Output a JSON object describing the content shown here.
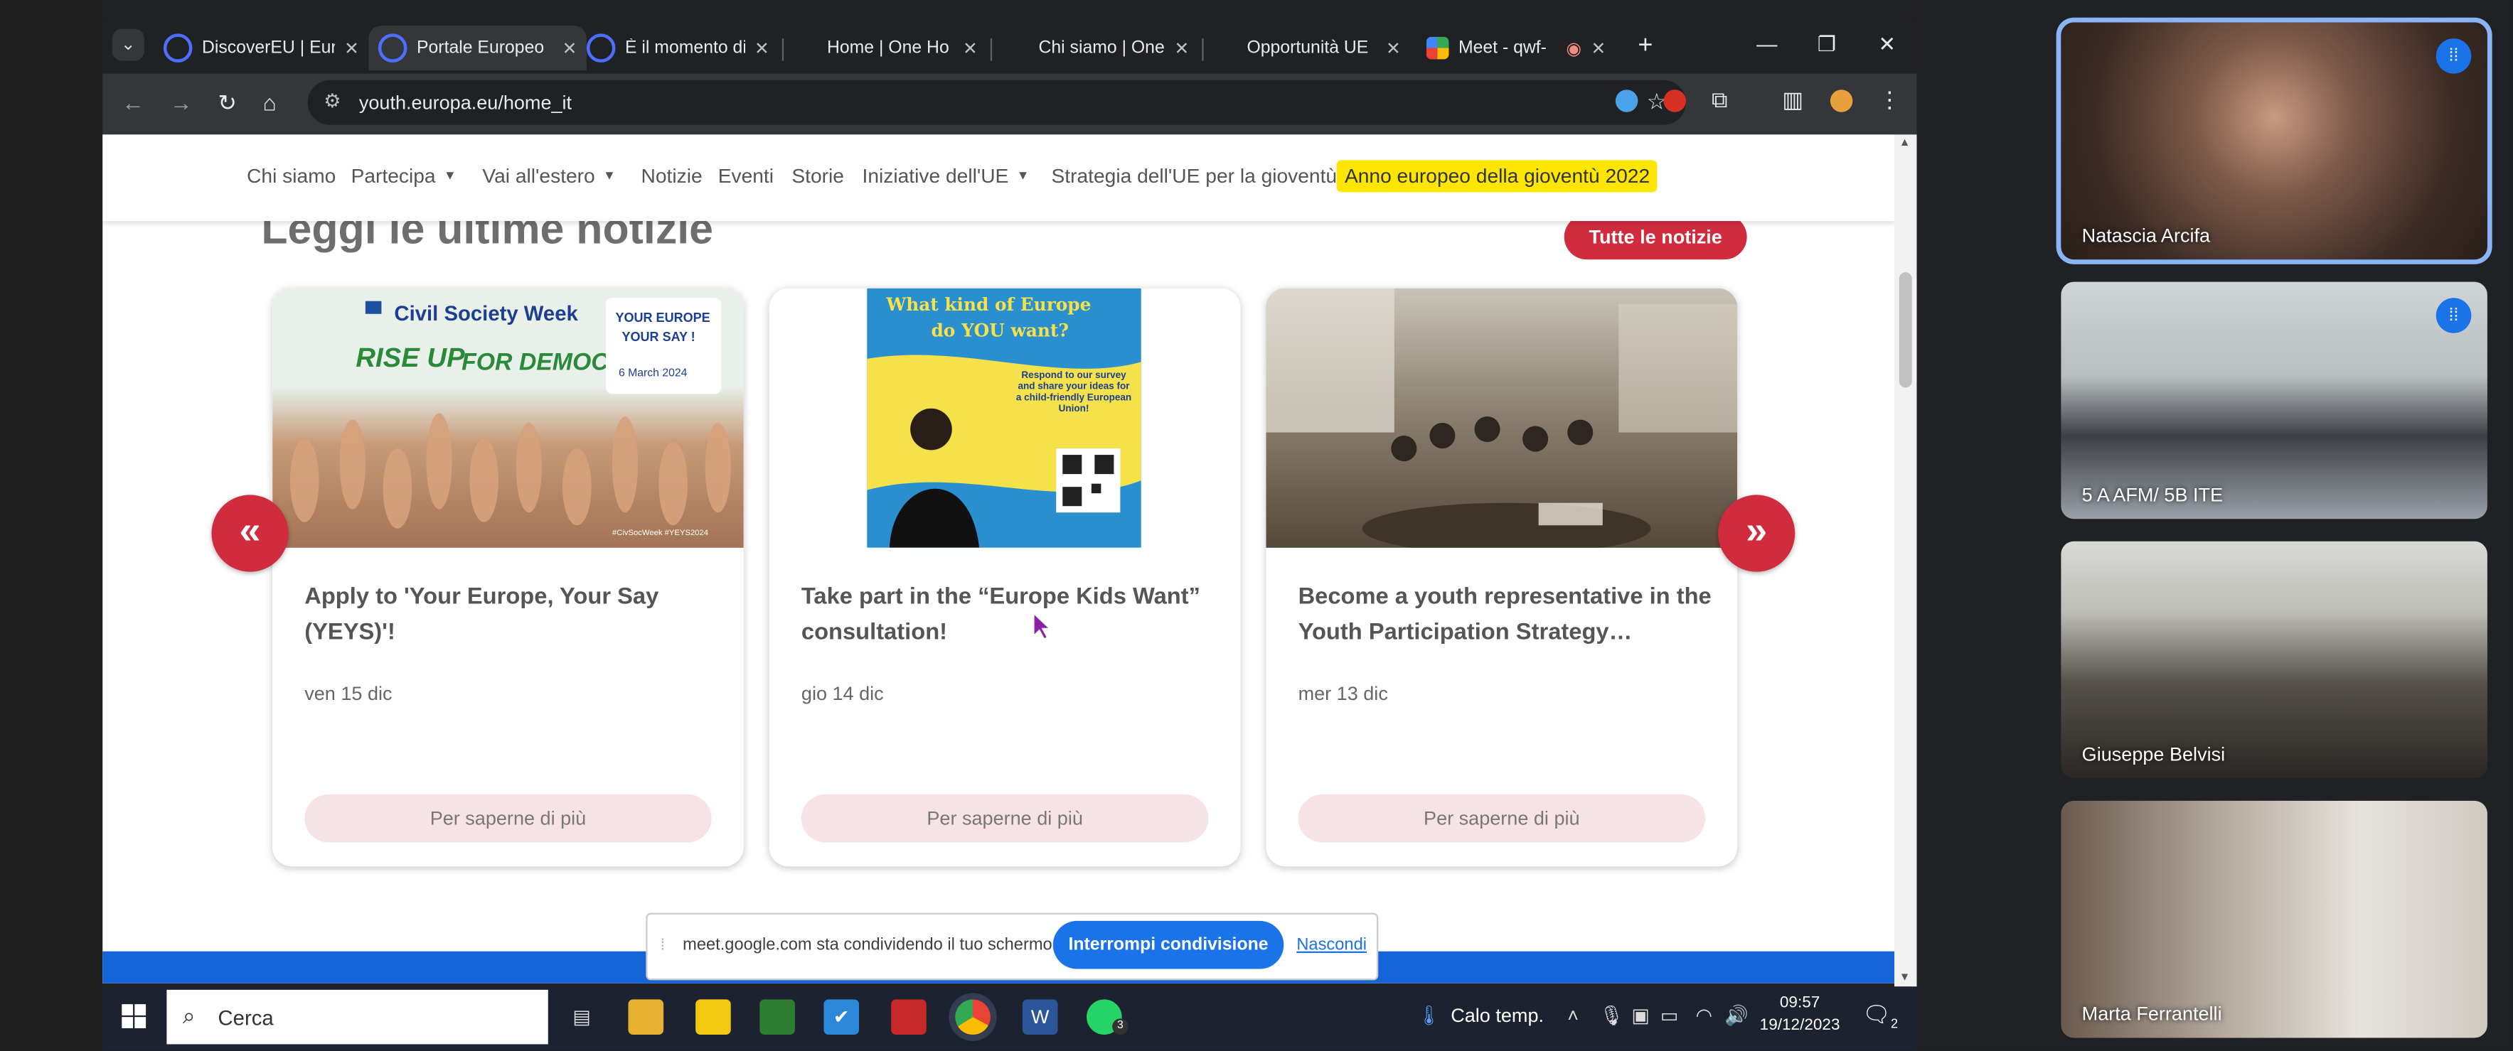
{
  "browser": {
    "tabs": [
      {
        "label": "DiscoverEU | Eur",
        "icon": "eu-flag-icon",
        "active": false
      },
      {
        "label": "Portale Europeo",
        "icon": "eu-flag-icon",
        "active": true
      },
      {
        "label": "È il momento di",
        "icon": "eu-flag-icon",
        "active": false
      },
      {
        "label": "Home | One Ho",
        "icon": "",
        "active": false
      },
      {
        "label": "Chi siamo | One",
        "icon": "",
        "active": false
      },
      {
        "label": "Opportunità UE",
        "icon": "",
        "active": false
      },
      {
        "label": "Meet - qwf-",
        "icon": "meet-icon",
        "active": false
      }
    ],
    "url": "youth.europa.eu/home_it"
  },
  "site_nav": {
    "items": [
      "Chi siamo",
      "Partecipa",
      "Vai all'estero",
      "Notizie",
      "Eventi",
      "Storie",
      "Iniziative dell'UE",
      "Strategia dell'UE per la gioventù"
    ],
    "highlight": "Anno europeo della gioventù 2022"
  },
  "news": {
    "heading": "Leggi le ultime notizie",
    "all_news_label": "Tutte le notizie",
    "cards": [
      {
        "title": "Apply to 'Your Europe, Your Say (YEYS)'!",
        "date": "ven 15 dic",
        "button": "Per saperne di più",
        "image": {
          "headline": "Civil Society Week",
          "slogan_1": "RISE UP",
          "slogan_2": "FOR DEMOCRACY",
          "badge_1": "YOUR EUROPE",
          "badge_2": "YOUR SAY !",
          "badge_date": "6 March 2024",
          "hashtags": "#CivSocWeek #YEYS2024"
        }
      },
      {
        "title": "Take part in the “Europe Kids Want” consultation!",
        "date": "gio 14 dic",
        "button": "Per saperne di più",
        "image": {
          "headline_1": "What kind of Europe",
          "headline_2": "do YOU want?",
          "body": "Respond to our survey and share your ideas for a child-friendly European Union!"
        }
      },
      {
        "title": "Become a youth representative in the Youth Participation Strategy…",
        "date": "mer 13 dic",
        "button": "Per saperne di più",
        "image": {}
      }
    ]
  },
  "share_bar": {
    "text": "meet.google.com sta condividendo il tuo schermo.",
    "stop_label": "Interrompi condivisione",
    "hide_label": "Nascondi"
  },
  "taskbar": {
    "search_placeholder": "Cerca",
    "whatsapp_badge": "3",
    "weather": "Calo temp.",
    "time": "09:57",
    "date": "19/12/2023",
    "notification_count": "2"
  },
  "participants": [
    {
      "name": "Natascia Arcifa",
      "speaking": true
    },
    {
      "name": "5 A AFM/ 5B ITE",
      "speaking": true
    },
    {
      "name": "Giuseppe Belvisi",
      "speaking": false
    },
    {
      "name": "Marta Ferrantelli",
      "speaking": false
    }
  ],
  "colors": {
    "brand_red": "#d12b3e",
    "highlight_yellow": "#ffe600",
    "meet_blue": "#1a73e8",
    "footer_blue": "#1565d8"
  }
}
